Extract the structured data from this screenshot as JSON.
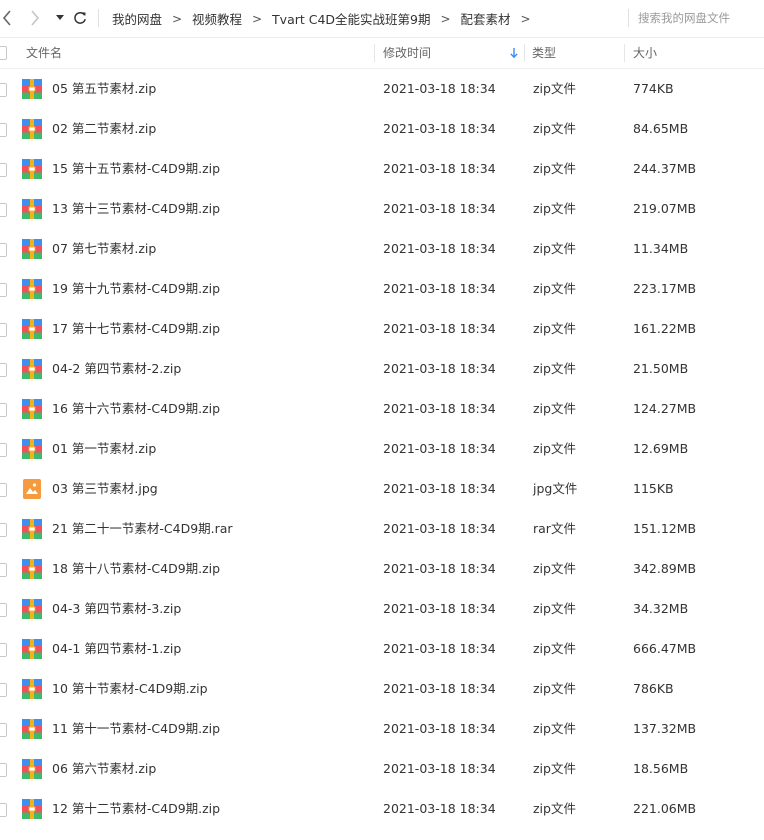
{
  "toolbar": {
    "breadcrumbs": [
      "我的网盘",
      "视频教程",
      "Tvart C4D全能实战班第9期",
      "配套素材"
    ],
    "arrow": ">",
    "search_placeholder": "搜索我的网盘文件"
  },
  "columns": {
    "name": "文件名",
    "modified": "修改时间",
    "type": "类型",
    "size": "大小"
  },
  "sort": {
    "column": "modified",
    "direction": "descending"
  },
  "colors": {
    "archive_top": "#3f8ff0",
    "archive_middle": "#f2505a",
    "archive_bottom": "#3fb96b",
    "archive_zipper": "#f3b321",
    "image_icon": "#f59b3d",
    "sort_arrow": "#3b8cf2"
  },
  "files": [
    {
      "name": "05 第五节素材.zip",
      "modified": "2021-03-18 18:34",
      "type": "zip文件",
      "size": "774KB",
      "icon": "archive-icon"
    },
    {
      "name": "02 第二节素材.zip",
      "modified": "2021-03-18 18:34",
      "type": "zip文件",
      "size": "84.65MB",
      "icon": "archive-icon"
    },
    {
      "name": "15 第十五节素材-C4D9期.zip",
      "modified": "2021-03-18 18:34",
      "type": "zip文件",
      "size": "244.37MB",
      "icon": "archive-icon"
    },
    {
      "name": "13 第十三节素材-C4D9期.zip",
      "modified": "2021-03-18 18:34",
      "type": "zip文件",
      "size": "219.07MB",
      "icon": "archive-icon"
    },
    {
      "name": "07 第七节素材.zip",
      "modified": "2021-03-18 18:34",
      "type": "zip文件",
      "size": "11.34MB",
      "icon": "archive-icon"
    },
    {
      "name": "19 第十九节素材-C4D9期.zip",
      "modified": "2021-03-18 18:34",
      "type": "zip文件",
      "size": "223.17MB",
      "icon": "archive-icon"
    },
    {
      "name": "17 第十七节素材-C4D9期.zip",
      "modified": "2021-03-18 18:34",
      "type": "zip文件",
      "size": "161.22MB",
      "icon": "archive-icon"
    },
    {
      "name": "04-2 第四节素材-2.zip",
      "modified": "2021-03-18 18:34",
      "type": "zip文件",
      "size": "21.50MB",
      "icon": "archive-icon"
    },
    {
      "name": "16 第十六节素材-C4D9期.zip",
      "modified": "2021-03-18 18:34",
      "type": "zip文件",
      "size": "124.27MB",
      "icon": "archive-icon"
    },
    {
      "name": "01 第一节素材.zip",
      "modified": "2021-03-18 18:34",
      "type": "zip文件",
      "size": "12.69MB",
      "icon": "archive-icon"
    },
    {
      "name": "03 第三节素材.jpg",
      "modified": "2021-03-18 18:34",
      "type": "jpg文件",
      "size": "115KB",
      "icon": "image-icon"
    },
    {
      "name": "21 第二十一节素材-C4D9期.rar",
      "modified": "2021-03-18 18:34",
      "type": "rar文件",
      "size": "151.12MB",
      "icon": "archive-icon"
    },
    {
      "name": "18 第十八节素材-C4D9期.zip",
      "modified": "2021-03-18 18:34",
      "type": "zip文件",
      "size": "342.89MB",
      "icon": "archive-icon"
    },
    {
      "name": "04-3 第四节素材-3.zip",
      "modified": "2021-03-18 18:34",
      "type": "zip文件",
      "size": "34.32MB",
      "icon": "archive-icon"
    },
    {
      "name": "04-1 第四节素材-1.zip",
      "modified": "2021-03-18 18:34",
      "type": "zip文件",
      "size": "666.47MB",
      "icon": "archive-icon"
    },
    {
      "name": "10 第十节素材-C4D9期.zip",
      "modified": "2021-03-18 18:34",
      "type": "zip文件",
      "size": "786KB",
      "icon": "archive-icon"
    },
    {
      "name": "11 第十一节素材-C4D9期.zip",
      "modified": "2021-03-18 18:34",
      "type": "zip文件",
      "size": "137.32MB",
      "icon": "archive-icon"
    },
    {
      "name": "06 第六节素材.zip",
      "modified": "2021-03-18 18:34",
      "type": "zip文件",
      "size": "18.56MB",
      "icon": "archive-icon"
    },
    {
      "name": "12 第十二节素材-C4D9期.zip",
      "modified": "2021-03-18 18:34",
      "type": "zip文件",
      "size": "221.06MB",
      "icon": "archive-icon"
    }
  ]
}
